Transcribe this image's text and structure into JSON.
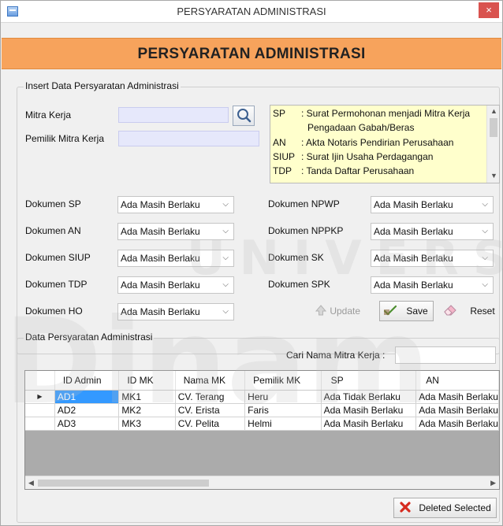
{
  "window": {
    "title": "PERSYARATAN ADMINISTRASI",
    "close_glyph": "×"
  },
  "header": {
    "title": "PERSYARATAN ADMINISTRASI"
  },
  "insert_group": {
    "title": "Insert Data Persyaratan Administrasi",
    "mitra_kerja_label": "Mitra Kerja",
    "pemilik_label": "Pemilik Mitra Kerja",
    "mitra_kerja_value": "",
    "pemilik_value": ""
  },
  "legend": [
    {
      "code": "SP",
      "desc": ": Surat Permohonan menjadi Mitra Kerja"
    },
    {
      "code": "",
      "desc": "  Pengadaan Gabah/Beras"
    },
    {
      "code": "AN",
      "desc": ": Akta Notaris Pendirian Perusahaan"
    },
    {
      "code": "SIUP",
      "desc": ": Surat Ijin Usaha Perdagangan"
    },
    {
      "code": "TDP",
      "desc": ": Tanda Daftar Perusahaan"
    }
  ],
  "dokumen_left": [
    {
      "label": "Dokumen SP",
      "value": "Ada Masih Berlaku"
    },
    {
      "label": "Dokumen AN",
      "value": "Ada Masih Berlaku"
    },
    {
      "label": "Dokumen SIUP",
      "value": "Ada Masih Berlaku"
    },
    {
      "label": "Dokumen TDP",
      "value": "Ada Masih Berlaku"
    },
    {
      "label": "Dokumen HO",
      "value": "Ada Masih Berlaku"
    }
  ],
  "dokumen_right": [
    {
      "label": "Dokumen NPWP",
      "value": "Ada Masih Berlaku"
    },
    {
      "label": "Dokumen NPPKP",
      "value": "Ada Masih Berlaku"
    },
    {
      "label": "Dokumen SK",
      "value": "Ada Masih Berlaku"
    },
    {
      "label": "Dokumen SPK",
      "value": "Ada Masih Berlaku"
    }
  ],
  "actions": {
    "update": "Update",
    "save": "Save",
    "reset": "Reset"
  },
  "data_group": {
    "title": "Data Persyaratan Administrasi",
    "search_label": "Cari Nama Mitra Kerja :",
    "search_value": ""
  },
  "grid": {
    "columns": [
      "",
      "ID Admin",
      "ID MK",
      "Nama MK",
      "Pemilik MK",
      "SP",
      "AN"
    ],
    "rows": [
      [
        "▶",
        "AD1",
        "MK1",
        "CV. Terang",
        "Heru",
        "Ada Tidak Berlaku",
        "Ada Masih Berlaku"
      ],
      [
        "",
        "AD2",
        "MK2",
        "CV. Erista",
        "Faris",
        "Ada Masih Berlaku",
        "Ada Masih Berlaku"
      ],
      [
        "",
        "AD3",
        "MK3",
        "CV. Pelita",
        "Helmi",
        "Ada Masih Berlaku",
        "Ada Masih Berlaku"
      ]
    ]
  },
  "footer": {
    "delete_label": "Deleted Selected"
  },
  "watermark": {
    "text_1": "UNIVERSITA",
    "text_2": "Dinam"
  },
  "colors": {
    "banner": "#f7a35c",
    "legend_bg": "#ffffcc",
    "input_bg": "#e6e8fb",
    "selection": "#3399ff",
    "close": "#d9534f"
  }
}
